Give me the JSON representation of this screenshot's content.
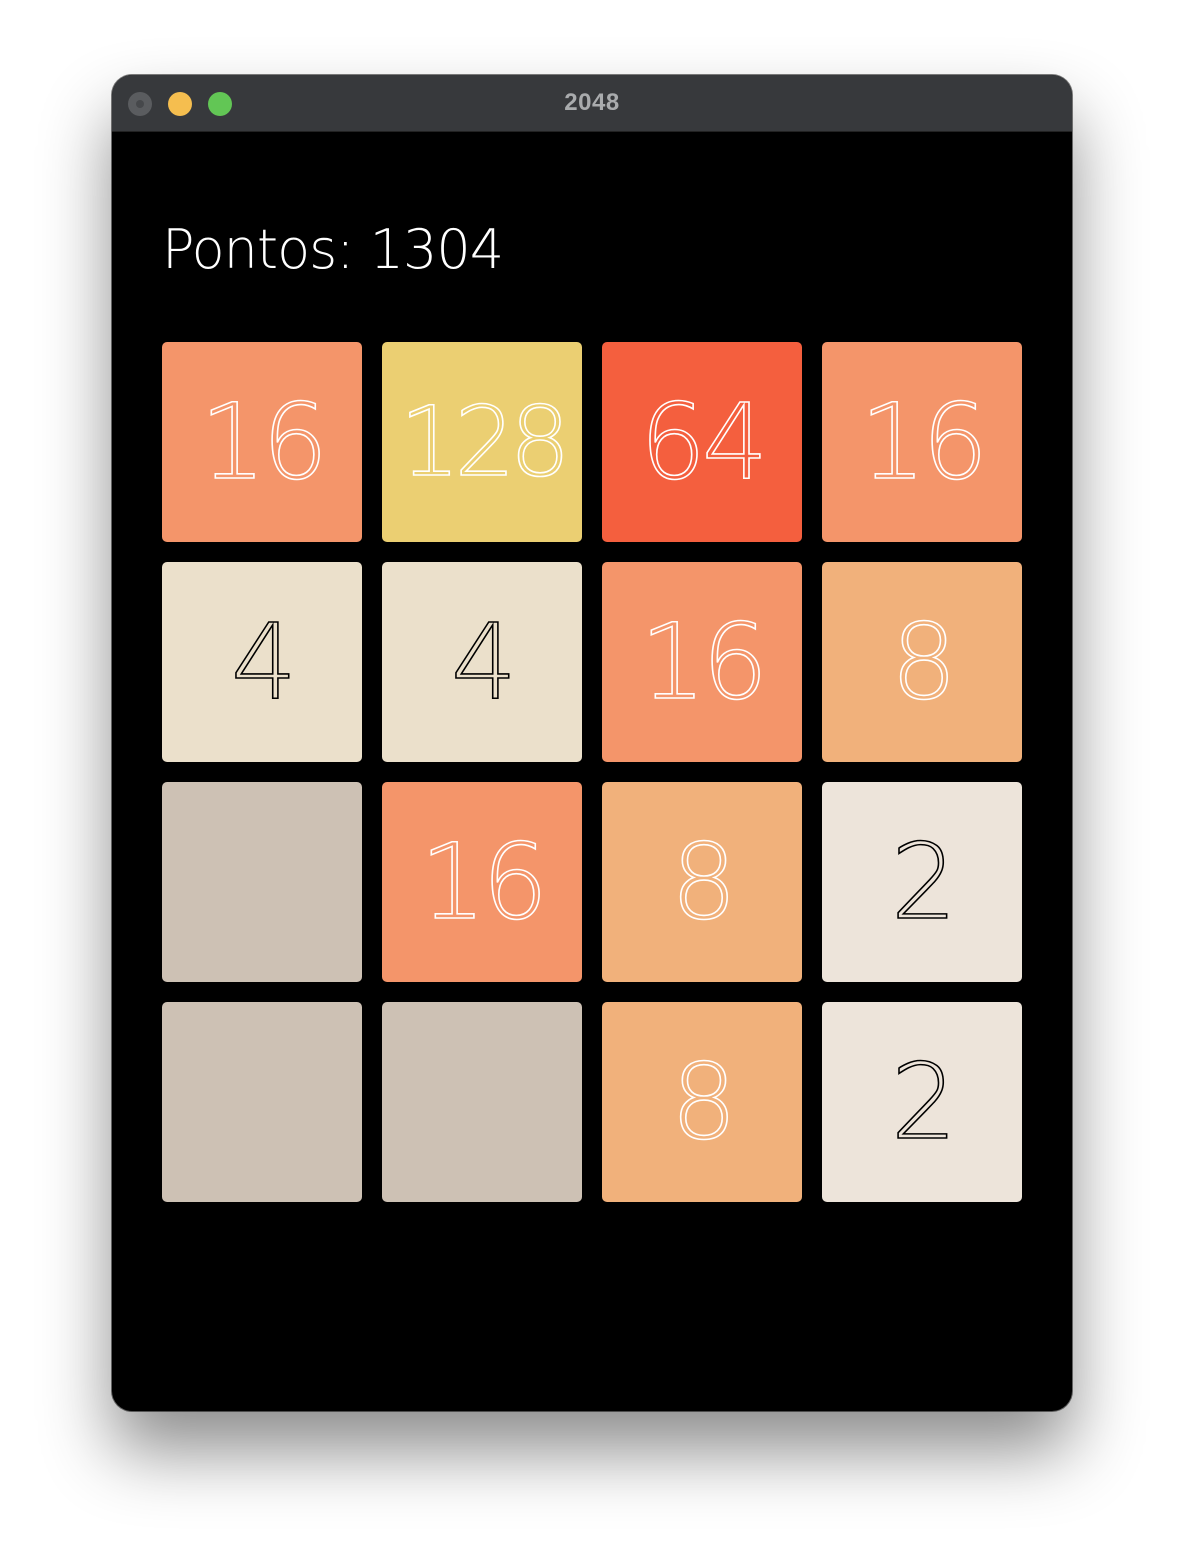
{
  "window": {
    "title": "2048"
  },
  "score": {
    "label": "Pontos:",
    "value": "1304"
  },
  "board": {
    "rows": [
      [
        {
          "value": "16",
          "color": "#f4956a",
          "text_color": "#ffffff"
        },
        {
          "value": "128",
          "color": "#ebcf72",
          "text_color": "#ffffff"
        },
        {
          "value": "64",
          "color": "#f45f3e",
          "text_color": "#ffffff"
        },
        {
          "value": "16",
          "color": "#f4956a",
          "text_color": "#ffffff"
        }
      ],
      [
        {
          "value": "4",
          "color": "#ebe0cb",
          "text_color": "#000000"
        },
        {
          "value": "4",
          "color": "#ebe0cb",
          "text_color": "#000000"
        },
        {
          "value": "16",
          "color": "#f4956a",
          "text_color": "#ffffff"
        },
        {
          "value": "8",
          "color": "#f1b17b",
          "text_color": "#ffffff"
        }
      ],
      [
        {
          "value": "",
          "color": "#cdc1b4",
          "text_color": "#ffffff"
        },
        {
          "value": "16",
          "color": "#f4956a",
          "text_color": "#ffffff"
        },
        {
          "value": "8",
          "color": "#f1b17b",
          "text_color": "#ffffff"
        },
        {
          "value": "2",
          "color": "#ede4da",
          "text_color": "#000000"
        }
      ],
      [
        {
          "value": "",
          "color": "#cdc1b4",
          "text_color": "#ffffff"
        },
        {
          "value": "",
          "color": "#cdc1b4",
          "text_color": "#ffffff"
        },
        {
          "value": "8",
          "color": "#f1b17b",
          "text_color": "#ffffff"
        },
        {
          "value": "2",
          "color": "#ede4da",
          "text_color": "#000000"
        }
      ]
    ]
  }
}
